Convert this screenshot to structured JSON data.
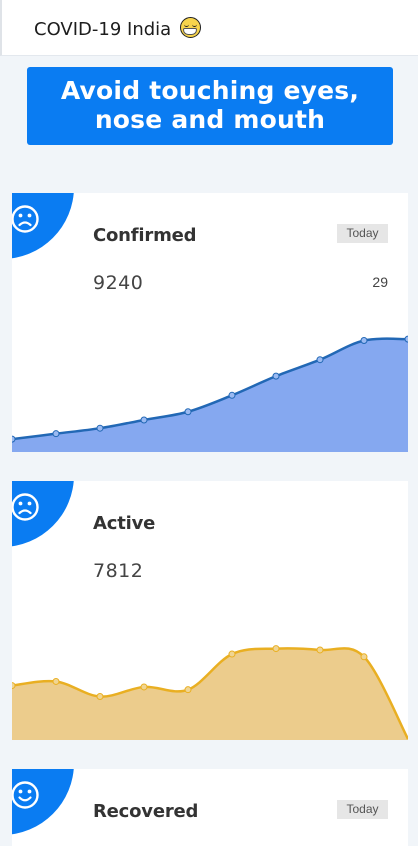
{
  "header": {
    "title": "COVID-19 India"
  },
  "banner": {
    "text": "Avoid touching eyes, nose and mouth"
  },
  "cards": {
    "confirmed": {
      "title": "Confirmed",
      "count": "9240",
      "delta": "29",
      "badge": "Today"
    },
    "active": {
      "title": "Active",
      "count": "7812"
    },
    "recovered": {
      "title": "Recovered",
      "badge": "Today"
    }
  },
  "colors": {
    "accent": "#0a7cf2",
    "confirmed_fill": "#85a8f0",
    "confirmed_line": "#2268b5",
    "active_fill": "#eccc8c",
    "active_line": "#e9af22"
  },
  "icons": {
    "header": "mask-face-icon",
    "sad": "sad-face-icon",
    "happy": "smile-face-icon"
  },
  "chart_data": [
    {
      "type": "area",
      "series": [
        {
          "values": [
            0.05,
            0.09,
            0.13,
            0.19,
            0.25,
            0.37,
            0.51,
            0.63,
            0.77,
            0.78
          ]
        }
      ]
    },
    {
      "type": "area",
      "series": [
        {
          "values": [
            0.39,
            0.42,
            0.31,
            0.38,
            0.36,
            0.62,
            0.66,
            0.65,
            0.6,
            0.0
          ]
        }
      ]
    }
  ]
}
